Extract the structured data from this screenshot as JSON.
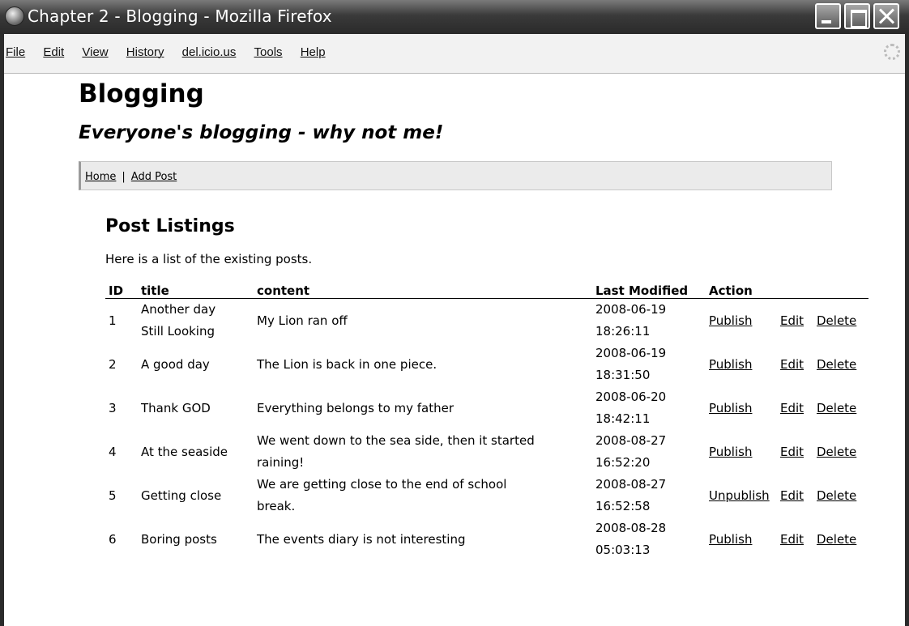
{
  "window": {
    "title": "Chapter 2 - Blogging - Mozilla Firefox"
  },
  "menu": {
    "items": [
      "File",
      "Edit",
      "View",
      "History",
      "del.icio.us",
      "Tools",
      "Help"
    ]
  },
  "site": {
    "title": "Blogging",
    "subtitle": "Everyone's blogging - why not me!"
  },
  "nav": {
    "home": "Home",
    "separator": "|",
    "add_post": "Add Post"
  },
  "page": {
    "heading": "Post Listings",
    "intro": "Here is a list of the existing posts."
  },
  "table": {
    "headers": {
      "id": "ID",
      "title": "title",
      "content": "content",
      "modified": "Last Modified",
      "action": "Action"
    },
    "rows": [
      {
        "id": "1",
        "title_1": "Another day",
        "title_2": "Still Looking",
        "content_1": "My Lion ran off",
        "content_2": "",
        "date": "2008-06-19",
        "time": "18:26:11",
        "publish": "Publish",
        "edit": "Edit",
        "delete": "Delete"
      },
      {
        "id": "2",
        "title_1": "A good day",
        "title_2": "",
        "content_1": "The Lion is back in one piece.",
        "content_2": "",
        "date": "2008-06-19",
        "time": "18:31:50",
        "publish": "Publish",
        "edit": "Edit",
        "delete": "Delete"
      },
      {
        "id": "3",
        "title_1": "Thank GOD",
        "title_2": "",
        "content_1": "Everything belongs to my father",
        "content_2": "",
        "date": "2008-06-20",
        "time": "18:42:11",
        "publish": "Publish",
        "edit": "Edit",
        "delete": "Delete"
      },
      {
        "id": "4",
        "title_1": "At the seaside",
        "title_2": "",
        "content_1": "We went down to the sea side, then it started",
        "content_2": "raining!",
        "date": "2008-08-27",
        "time": "16:52:20",
        "publish": "Publish",
        "edit": "Edit",
        "delete": "Delete"
      },
      {
        "id": "5",
        "title_1": "Getting close",
        "title_2": "",
        "content_1": "We are getting close to the end of school",
        "content_2": "break.",
        "date": "2008-08-27",
        "time": "16:52:58",
        "publish": "Unpublish",
        "edit": "Edit",
        "delete": "Delete"
      },
      {
        "id": "6",
        "title_1": "Boring posts",
        "title_2": "",
        "content_1": "The events diary is not interesting",
        "content_2": "",
        "date": "2008-08-28",
        "time": "05:03:13",
        "publish": "Publish",
        "edit": "Edit",
        "delete": "Delete"
      }
    ]
  }
}
